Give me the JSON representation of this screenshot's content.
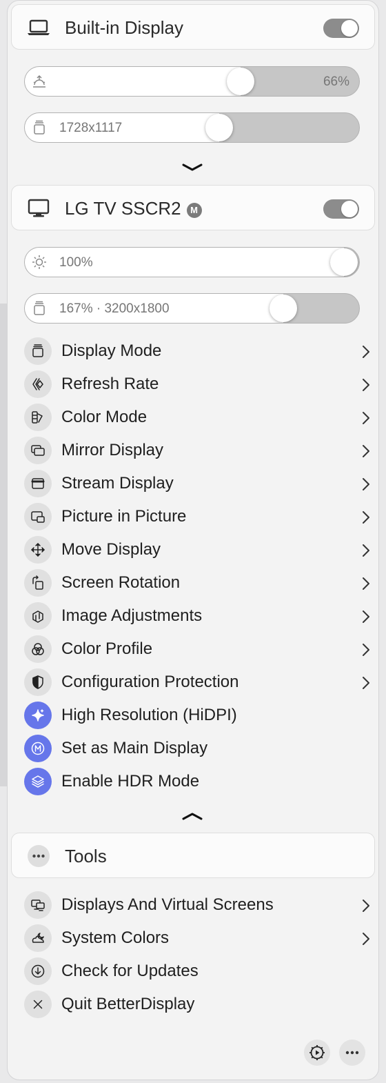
{
  "builtin": {
    "title": "Built-in Display",
    "toggle_on": true
  },
  "builtin_brightness": {
    "value_text": "66%",
    "fraction": 0.66
  },
  "builtin_resolution": {
    "label": "1728x1117",
    "fraction": 0.59
  },
  "lg": {
    "title": "LG TV SSCR2",
    "badge": "M",
    "toggle_on": true
  },
  "lg_brightness": {
    "label": "100%",
    "fraction": 1.0
  },
  "lg_resolution": {
    "label": "167% · 3200x1800",
    "fraction": 0.8
  },
  "menu": [
    {
      "label": "Display Mode",
      "icon": "display-mode-icon",
      "submenu": true
    },
    {
      "label": "Refresh Rate",
      "icon": "refresh-rate-icon",
      "submenu": true
    },
    {
      "label": "Color Mode",
      "icon": "color-mode-icon",
      "submenu": true
    },
    {
      "label": "Mirror Display",
      "icon": "mirror-display-icon",
      "submenu": true
    },
    {
      "label": "Stream Display",
      "icon": "stream-display-icon",
      "submenu": true
    },
    {
      "label": "Picture in Picture",
      "icon": "picture-in-picture-icon",
      "submenu": true
    },
    {
      "label": "Move Display",
      "icon": "move-display-icon",
      "submenu": true
    },
    {
      "label": "Screen Rotation",
      "icon": "screen-rotation-icon",
      "submenu": true
    },
    {
      "label": "Image Adjustments",
      "icon": "image-adjustments-icon",
      "submenu": true
    },
    {
      "label": "Color Profile",
      "icon": "color-profile-icon",
      "submenu": true
    },
    {
      "label": "Configuration Protection",
      "icon": "configuration-protection-icon",
      "submenu": true
    },
    {
      "label": "High Resolution (HiDPI)",
      "icon": "sparkle-icon",
      "submenu": false,
      "active": true
    },
    {
      "label": "Set as Main Display",
      "icon": "main-display-icon",
      "submenu": false,
      "active": true
    },
    {
      "label": "Enable HDR Mode",
      "icon": "hdr-layers-icon",
      "submenu": false,
      "active": true
    }
  ],
  "tools": {
    "title": "Tools"
  },
  "tools_menu": [
    {
      "label": "Displays And Virtual Screens",
      "icon": "displays-icon",
      "submenu": true
    },
    {
      "label": "System Colors",
      "icon": "system-colors-icon",
      "submenu": true
    },
    {
      "label": "Check for Updates",
      "icon": "download-icon",
      "submenu": false
    },
    {
      "label": "Quit BetterDisplay",
      "icon": "close-icon",
      "submenu": false
    }
  ],
  "colors": {
    "accent": "#6676ea",
    "toggle": "#8c8c8c"
  }
}
